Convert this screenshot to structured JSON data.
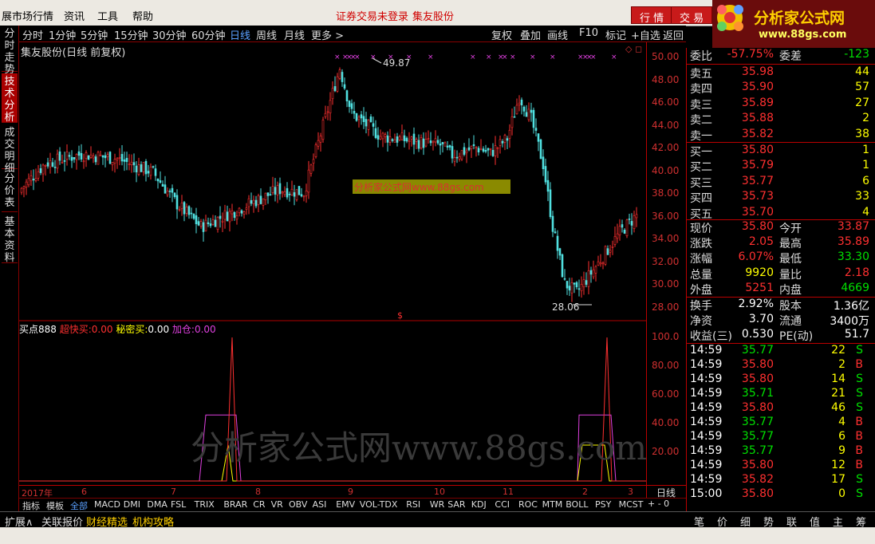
{
  "menu": {
    "items": [
      "展市场行情",
      "资讯",
      "工具",
      "帮助"
    ],
    "status_login": "证券交易未登录",
    "stock_name_top": "集友股份",
    "btn_quote": "行 情",
    "btn_trade": "交 易"
  },
  "logo": {
    "title": "分析家公式网",
    "url": "www.88gs.com"
  },
  "timeframes": [
    "分时",
    "1分钟",
    "5分钟",
    "15分钟",
    "30分钟",
    "60分钟",
    "日线",
    "周线",
    "月线",
    "更多 >"
  ],
  "active_timeframe": "日线",
  "tools": [
    "复权",
    "叠加",
    "画线",
    "F10",
    "标记",
    "+自选",
    "返回"
  ],
  "left_tabs": [
    "分时走势",
    "技术分析",
    "成交明细",
    "分价表",
    "基本资料"
  ],
  "active_left_tab": "技术分析",
  "chart_title": "集友股份(日线 前复权)",
  "chart_title_marks": "◇ ◻",
  "watermark_small": "分析家公式网www.88gs.com",
  "watermark_big": "分析家公式网www.88gs.com",
  "indicator": {
    "name": "买点888",
    "l1": "超快买:",
    "v1": "0.00",
    "l2": "秘密买:",
    "v2": "0.00",
    "l3": "加仓:",
    "v3": "0.00",
    "marker": "$"
  },
  "main_y_labels": [
    "50.00",
    "48.00",
    "46.00",
    "44.00",
    "42.00",
    "40.00",
    "38.00",
    "36.00",
    "34.00",
    "32.00",
    "30.00",
    "28.00"
  ],
  "ind_y_labels": [
    "100.0",
    "80.00",
    "60.00",
    "40.00",
    "20.00"
  ],
  "x_labels": [
    "2017年",
    "6",
    "7",
    "8",
    "9",
    "10",
    "11",
    "2",
    "3"
  ],
  "period_label": "日线",
  "period_ctrl": "+ - 0",
  "indicator_tabs": [
    "指标",
    "模板",
    "全部",
    "MACD",
    "DMI",
    "DMA",
    "FSL",
    "TRIX",
    "BRAR",
    "CR",
    "VR",
    "OBV",
    "ASI",
    "EMV",
    "VOL-TDX",
    "RSI",
    "WR",
    "SAR",
    "KDJ",
    "CCI",
    "ROC",
    "MTM",
    "BOLL",
    "PSY",
    "MCST"
  ],
  "bottom_tabs": [
    "扩展∧",
    "关联报价",
    "财经精选",
    "机构攻略"
  ],
  "right_tabs": [
    "笔",
    "价",
    "细",
    "势",
    "联",
    "值",
    "主",
    "筹"
  ],
  "annot": {
    "high": "49.87",
    "low": "28.06"
  },
  "order_book": {
    "weibi": {
      "label": "委比",
      "value": "-57.75%",
      "label2": "委差",
      "value2": "-123"
    },
    "sell": [
      {
        "label": "卖五",
        "price": "35.98",
        "vol": "44"
      },
      {
        "label": "卖四",
        "price": "35.90",
        "vol": "57"
      },
      {
        "label": "卖三",
        "price": "35.89",
        "vol": "27"
      },
      {
        "label": "卖二",
        "price": "35.88",
        "vol": "2"
      },
      {
        "label": "卖一",
        "price": "35.82",
        "vol": "38"
      }
    ],
    "buy": [
      {
        "label": "买一",
        "price": "35.80",
        "vol": "1"
      },
      {
        "label": "买二",
        "price": "35.79",
        "vol": "1"
      },
      {
        "label": "买三",
        "price": "35.77",
        "vol": "6"
      },
      {
        "label": "买四",
        "price": "35.73",
        "vol": "33"
      },
      {
        "label": "买五",
        "price": "35.70",
        "vol": "4"
      }
    ]
  },
  "stats": [
    {
      "l1": "现价",
      "v1": "35.80",
      "c1": "red",
      "l2": "今开",
      "v2": "33.87",
      "c2": "red"
    },
    {
      "l1": "涨跌",
      "v1": "2.05",
      "c1": "red",
      "l2": "最高",
      "v2": "35.89",
      "c2": "red"
    },
    {
      "l1": "涨幅",
      "v1": "6.07%",
      "c1": "red",
      "l2": "最低",
      "v2": "33.30",
      "c2": "green"
    },
    {
      "l1": "总量",
      "v1": "9920",
      "c1": "yellow",
      "l2": "量比",
      "v2": "2.18",
      "c2": "red"
    },
    {
      "l1": "外盘",
      "v1": "5251",
      "c1": "red",
      "l2": "内盘",
      "v2": "4669",
      "c2": "green"
    }
  ],
  "stats2": [
    {
      "l1": "换手",
      "v1": "2.92%",
      "l2": "股本",
      "v2": "1.36亿"
    },
    {
      "l1": "净资",
      "v1": "3.70",
      "l2": "流通",
      "v2": "3400万"
    },
    {
      "l1": "收益(三)",
      "v1": "0.530",
      "l2": "PE(动)",
      "v2": "51.7"
    }
  ],
  "ticks": [
    {
      "t": "14:59",
      "p": "35.77",
      "v": "22",
      "s": "S"
    },
    {
      "t": "14:59",
      "p": "35.80",
      "v": "2",
      "s": "B"
    },
    {
      "t": "14:59",
      "p": "35.80",
      "v": "14",
      "s": "S"
    },
    {
      "t": "14:59",
      "p": "35.71",
      "v": "21",
      "s": "S"
    },
    {
      "t": "14:59",
      "p": "35.80",
      "v": "46",
      "s": "S"
    },
    {
      "t": "14:59",
      "p": "35.77",
      "v": "4",
      "s": "B"
    },
    {
      "t": "14:59",
      "p": "35.77",
      "v": "6",
      "s": "B"
    },
    {
      "t": "14:59",
      "p": "35.77",
      "v": "9",
      "s": "B"
    },
    {
      "t": "14:59",
      "p": "35.80",
      "v": "12",
      "s": "B"
    },
    {
      "t": "14:59",
      "p": "35.82",
      "v": "17",
      "s": "S"
    },
    {
      "t": "15:00",
      "p": "35.80",
      "v": "0",
      "s": "S"
    }
  ],
  "colors": {
    "up": "#ff3030",
    "down": "#50e0e0",
    "bg": "#000000",
    "axis": "#b00000",
    "accent": "#c81a1a"
  }
}
